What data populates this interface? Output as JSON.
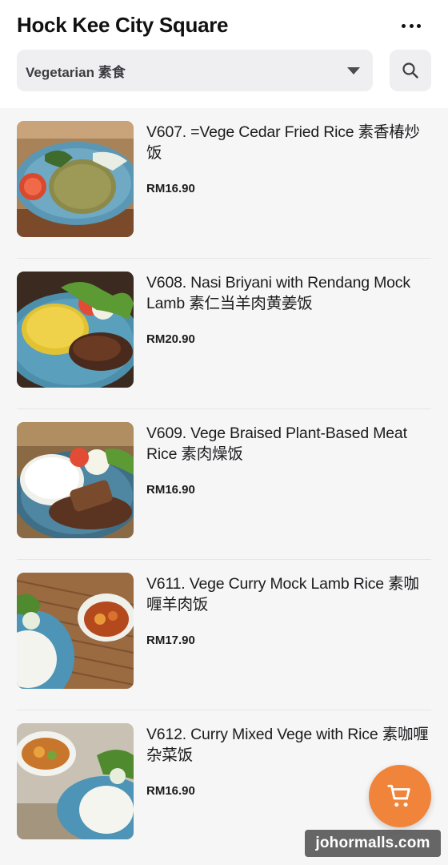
{
  "header": {
    "title": "Hock Kee City Square",
    "more_icon": "more-horizontal-icon",
    "category": {
      "selected": "Vegetarian 素食",
      "dropdown_icon": "caret-down-icon"
    },
    "search_icon": "search-icon"
  },
  "items": [
    {
      "name": "V607. =Vege Cedar Fried Rice 素香椿炒饭",
      "price": "RM16.90"
    },
    {
      "name": "V608. Nasi Briyani with Rendang Mock Lamb 素仁当羊肉黄姜饭",
      "price": "RM20.90"
    },
    {
      "name": "V609. Vege Braised Plant-Based Meat Rice 素肉燥饭",
      "price": "RM16.90"
    },
    {
      "name": "V611. Vege Curry Mock Lamb Rice 素咖喱羊肉饭",
      "price": "RM17.90"
    },
    {
      "name": "V612. Curry Mixed Vege with Rice 素咖喱杂菜饭",
      "price": "RM16.90"
    }
  ],
  "cart": {
    "icon": "shopping-cart-icon"
  },
  "watermark": "johormalls.com",
  "colors": {
    "accent": "#f0843a",
    "background": "#f6f6f7",
    "chip": "#efeff2"
  }
}
